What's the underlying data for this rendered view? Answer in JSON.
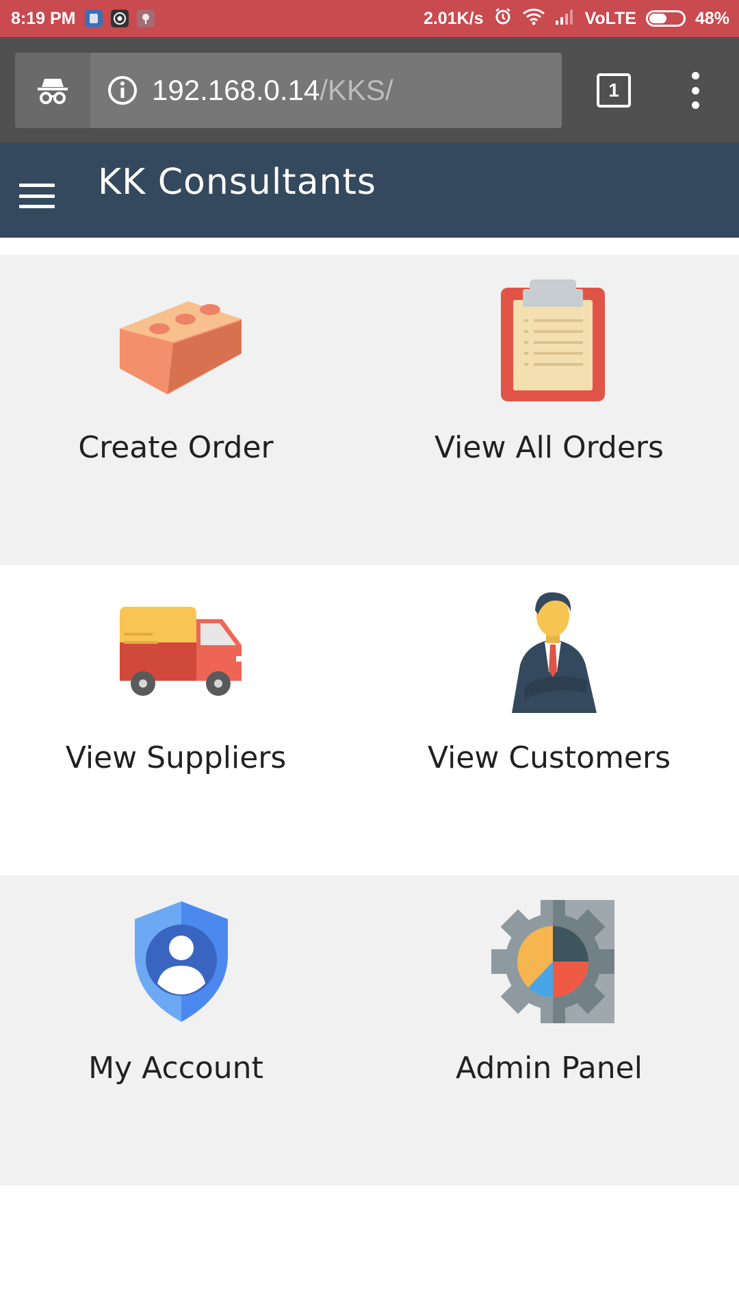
{
  "status_bar": {
    "time": "8:19 PM",
    "network_speed": "2.01K/s",
    "network_type": "VoLTE",
    "battery": "48%",
    "battery_level": 0.48,
    "icons": [
      "notification-app-icon",
      "chrome-icon",
      "notification-pin-icon",
      "alarm-icon",
      "wifi-icon",
      "signal-icon",
      "battery-icon"
    ]
  },
  "browser": {
    "url_host": "192.168.0.14",
    "url_path": "/KKS/",
    "tab_count": "1",
    "icons": [
      "incognito-icon",
      "info-icon",
      "tabs-icon",
      "more-vert-icon"
    ]
  },
  "header": {
    "title": "KK Consultants",
    "menu_icon": "hamburger-icon",
    "background": "#34495e"
  },
  "tiles": [
    {
      "label": "Create Order",
      "icon": "brick-icon"
    },
    {
      "label": "View All Orders",
      "icon": "clipboard-icon"
    },
    {
      "label": "View Suppliers",
      "icon": "truck-icon"
    },
    {
      "label": "View Customers",
      "icon": "businessman-icon"
    },
    {
      "label": "My Account",
      "icon": "account-shield-icon"
    },
    {
      "label": "Admin Panel",
      "icon": "gear-chart-icon"
    }
  ],
  "colors": {
    "status_bar": "#c94a4f",
    "browser_bar": "#505050",
    "row_shaded": "#f1f1f1"
  }
}
